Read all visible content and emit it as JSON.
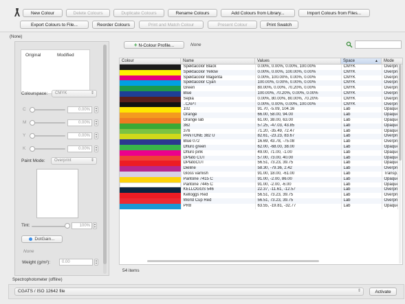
{
  "toolbar": {
    "row1": [
      {
        "label": "New Colour",
        "enabled": true
      },
      {
        "label": "Delete Colours",
        "enabled": false
      },
      {
        "label": "Duplicate Colours",
        "enabled": false
      },
      {
        "label": "Rename Colours",
        "enabled": true
      },
      {
        "label": "Add Colours from Library...",
        "enabled": true
      },
      {
        "label": "Import Colours from Files...",
        "enabled": true
      }
    ],
    "row2": [
      {
        "label": "Export Colours to File...",
        "enabled": true
      },
      {
        "label": "Reorder Colours",
        "enabled": true
      },
      {
        "label": "Print and Match Colour",
        "enabled": false
      },
      {
        "label": "Present Colour",
        "enabled": false
      },
      {
        "label": "Print Swatch",
        "enabled": true
      }
    ]
  },
  "section_label": "(None)",
  "left": {
    "original_label": "Original",
    "modified_label": "Modified",
    "colourspace_label": "Colourspace:",
    "colourspace_value": "CMYK",
    "channels": [
      {
        "label": "C",
        "value": "0.00%"
      },
      {
        "label": "M",
        "value": "0.00%"
      },
      {
        "label": "Y",
        "value": "0.00%"
      },
      {
        "label": "K",
        "value": "0.00%"
      }
    ],
    "paint_mode_label": "Paint Mode:",
    "paint_mode_value": "Overprint",
    "tint_label": "Tint:",
    "tint_value": "100%",
    "dotgain_label": "DotGain...",
    "dotgain_value": "None",
    "weight_label": "Weight (g/m²):",
    "weight_value": "0.00"
  },
  "main": {
    "profile_button": "N-Colour Profile...",
    "profile_value": "None",
    "search_placeholder": "",
    "columns": [
      "Colour",
      "Name",
      "Values",
      "Space",
      "Mode"
    ],
    "rows": [
      {
        "color": "#1b1b1b",
        "name": "Spektacolor Black",
        "values": "0.00%, 0.00%, 0.00%, 100.00%",
        "space": "CMYK",
        "mode": "Overpri"
      },
      {
        "color": "#fff200",
        "name": "Spektacolor Yellow",
        "values": "0.00%, 0.00%, 100.00%, 0.00%",
        "space": "CMYK",
        "mode": "Overpri"
      },
      {
        "color": "#e6007e",
        "name": "Spektacolor Magenta",
        "values": "0.00%, 100.00%, 0.00%, 0.00%",
        "space": "CMYK",
        "mode": "Overpri"
      },
      {
        "color": "#00a0e3",
        "name": "Spektacolor Cyan",
        "values": "100.00%, 0.00%, 0.00%, 0.00%",
        "space": "CMYK",
        "mode": "Overpri"
      },
      {
        "color": "#1d9a4b",
        "name": "Green",
        "values": "80.00%, 0.00%, 70.20%, 0.00%",
        "space": "CMYK",
        "mode": "Overpri"
      },
      {
        "color": "#1e3f95",
        "name": "Blue",
        "values": "100.00%, 70.20%, 0.00%, 0.00%",
        "space": "CMYK",
        "mode": "Overpri"
      },
      {
        "color": "#5a1f1a",
        "name": "Sepia",
        "values": "0.00%, 80.00%, 80.00%, 70.20%",
        "space": "CMYK",
        "mode": "Overpri"
      },
      {
        "color": "#121212",
        "name": "..CAPT",
        "values": "0.00%, 0.00%, 0.00%, 100.00%",
        "space": "CMYK",
        "mode": "Overpri"
      },
      {
        "color": "#ffe600",
        "name": "102",
        "values": "91.70, -5.09, 104.16",
        "space": "Lab",
        "mode": "Opaque"
      },
      {
        "color": "#f49a1f",
        "name": "Orange",
        "values": "66.00, 58.00, 94.00",
        "space": "Lab",
        "mode": "Opaque"
      },
      {
        "color": "#ee7b22",
        "name": "Orange lab",
        "values": "61.00, 38.00, 63.00",
        "space": "Lab",
        "mode": "Opaque"
      },
      {
        "color": "#3aa935",
        "name": "362",
        "values": "57.25, -47.03, 43.85",
        "space": "Lab",
        "mode": "Opaque"
      },
      {
        "color": "#7cc242",
        "name": "376",
        "values": "71.20, -35.49, 72.47",
        "space": "Lab",
        "mode": "Opaque"
      },
      {
        "color": "#d0d81a",
        "name": "PANTONE 382 U",
        "values": "82.61, -23.23, 83.67",
        "space": "Lab",
        "mode": "Overpri"
      },
      {
        "color": "#2b3990",
        "name": "Blue 072",
        "values": "16.69, 43.78, -75.08",
        "space": "Lab",
        "mode": "Overpri"
      },
      {
        "color": "#39b54a",
        "name": "Dfluro green",
        "values": "62.00, -68.00, 38.00",
        "space": "Lab",
        "mode": "Opaque"
      },
      {
        "color": "#ec008c",
        "name": "Dfluro pink",
        "values": "49.00, 71.00, -1.00",
        "space": "Lab",
        "mode": "Opaque"
      },
      {
        "color": "#ef4136",
        "name": "DPlato CUT",
        "values": "57.00, 73.00, 40.00",
        "space": "Lab",
        "mode": "Opaque"
      },
      {
        "color": "#ed1c24",
        "name": "DPlatoCUT",
        "values": "56.51, 73.23, 39.75",
        "space": "Lab",
        "mode": "Opaque"
      },
      {
        "color": "#b8278f",
        "name": "Dieline",
        "values": "58.30, -79.36, 2.42",
        "space": "Lab",
        "mode": "Overpri"
      },
      {
        "color": "#d7d0e8",
        "name": "Gloss varnish",
        "values": "91.00, 18.00, -61.00",
        "space": "Lab",
        "mode": "Transp."
      },
      {
        "color": "#fdd20a",
        "name": "Pantone 7415 C",
        "values": "91.00, -2.00, 86.00",
        "space": "Lab",
        "mode": "Opaque"
      },
      {
        "color": "#ffffff",
        "name": "Pantone 7445 C",
        "values": "91.00, -2.00, -6.00",
        "space": "Lab",
        "mode": "Opaque"
      },
      {
        "color": "#0d2440",
        "name": "KELLOGGS 546",
        "values": "22.37, -11.61, -12.57",
        "space": "Lab",
        "mode": "Overpri"
      },
      {
        "color": "#ed1c24",
        "name": "Kelloggs Red",
        "values": "56.51, 73.23, 39.75",
        "space": "Lab",
        "mode": "Overpri"
      },
      {
        "color": "#ee2a33",
        "name": "World Cup Red",
        "values": "56.51, 73.23, 39.75",
        "space": "Lab",
        "mode": "Overpri"
      },
      {
        "color": "#1c97d4",
        "name": "PR8",
        "values": "63.55, -19.81, -32.77",
        "space": "Lab",
        "mode": "Opaque"
      }
    ],
    "item_count": "54 items"
  },
  "spectro": {
    "label": "Spectrophotometer (offline)",
    "device_value": "CGATS / ISO 12642 file",
    "activate_label": "Activate"
  }
}
